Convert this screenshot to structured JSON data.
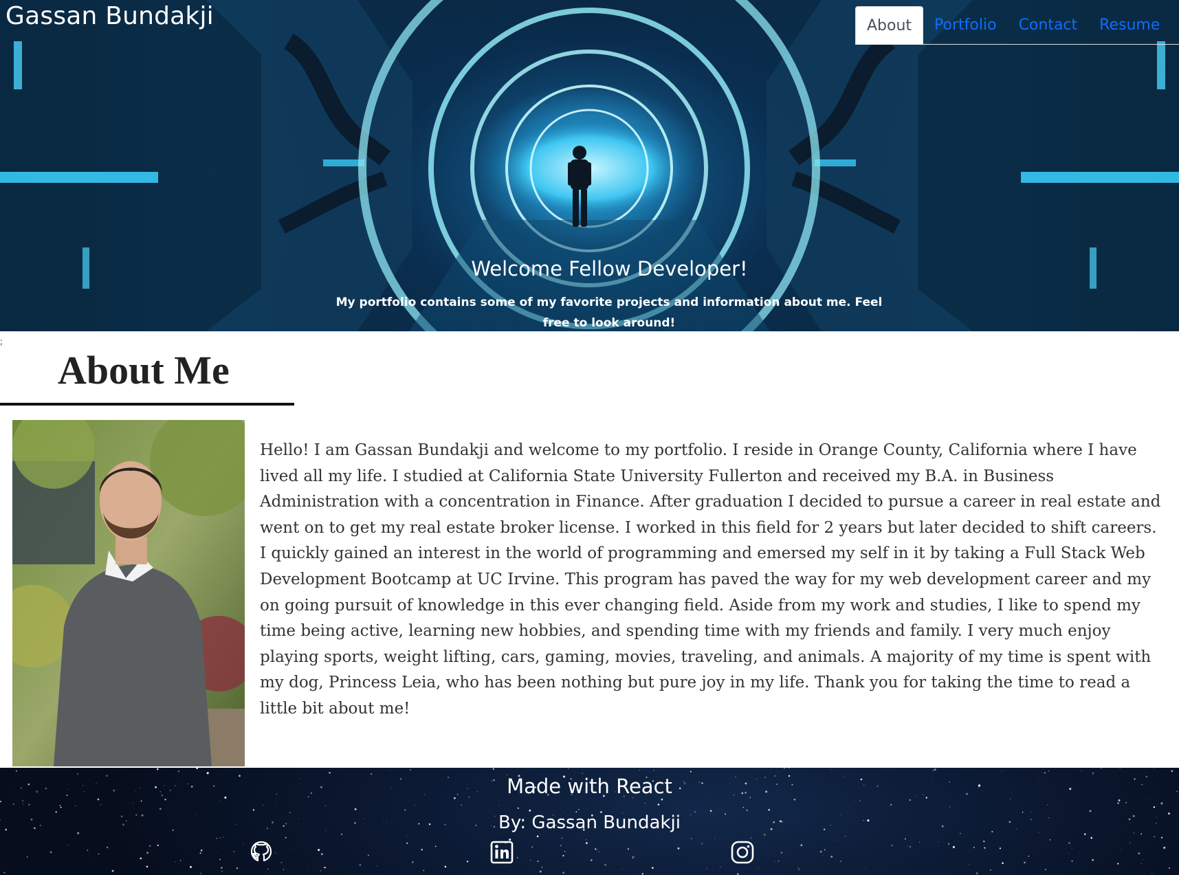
{
  "header": {
    "brand": "Gassan Bundakji",
    "nav": [
      {
        "label": "About",
        "active": true
      },
      {
        "label": "Portfolio",
        "active": false
      },
      {
        "label": "Contact",
        "active": false
      },
      {
        "label": "Resume",
        "active": false
      }
    ],
    "hero_title": "Welcome Fellow Developer!",
    "hero_subtitle": "My portfolio contains some of my favorite projects and information about me. Feel free to look around!"
  },
  "about": {
    "stray_mark": ";",
    "title": "About Me",
    "bio": "Hello! I am Gassan Bundakji and welcome to my portfolio. I reside in Orange County, California where I have lived all my life. I studied at California State University Fullerton and received my B.A. in Business Administration with a concentration in Finance. After graduation I decided to pursue a career in real estate and went on to get my real estate broker license. I worked in this field for 2 years but later decided to shift careers. I quickly gained an interest in the world of programming and emersed my self in it by taking a Full Stack Web Development Bootcamp at UC Irvine. This program has paved the way for my web development career and my on going pursuit of knowledge in this ever changing field. Aside from my work and studies, I like to spend my time being active, learning new hobbies, and spending time with my friends and family. I very much enjoy playing sports, weight lifting, cars, gaming, movies, traveling, and animals. A majority of my time is spent with my dog, Princess Leia, who has been nothing but pure joy in my life. Thank you for taking the time to read a little bit about me!"
  },
  "footer": {
    "made_with": "Made with React",
    "by": "By: Gassan Bundakji",
    "icons": [
      "github-icon",
      "linkedin-icon",
      "instagram-icon"
    ]
  },
  "colors": {
    "nav_link": "#0d6efd",
    "nav_active_text": "#495057",
    "hero_glow": "#4fd8ff",
    "footer_bg": "#0b1830"
  }
}
